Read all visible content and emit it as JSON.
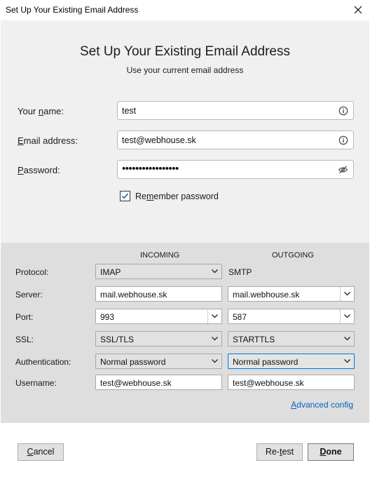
{
  "window": {
    "title": "Set Up Your Existing Email Address"
  },
  "header": {
    "title": "Set Up Your Existing Email Address",
    "subtitle": "Use your current email address"
  },
  "form": {
    "name": {
      "label_pre": "Your ",
      "label_key": "n",
      "label_post": "ame:",
      "value": "test"
    },
    "email": {
      "label_pre": "",
      "label_key": "E",
      "label_post": "mail address:",
      "value": "test@webhouse.sk"
    },
    "password": {
      "label_pre": "",
      "label_key": "P",
      "label_post": "assword:",
      "value": "•••••••••••••••••"
    },
    "remember": {
      "label_pre": "Re",
      "label_key": "m",
      "label_post": "ember password",
      "checked": true
    }
  },
  "config": {
    "incoming_header": "INCOMING",
    "outgoing_header": "OUTGOING",
    "labels": {
      "protocol": "Protocol:",
      "server": "Server:",
      "port": "Port:",
      "ssl": "SSL:",
      "authentication": "Authentication:",
      "username": "Username:"
    },
    "incoming": {
      "protocol": "IMAP",
      "server": "mail.webhouse.sk",
      "port": "993",
      "ssl": "SSL/TLS",
      "authentication": "Normal password",
      "username": "test@webhouse.sk"
    },
    "outgoing": {
      "protocol": "SMTP",
      "server": "mail.webhouse.sk",
      "port": "587",
      "ssl": "STARTTLS",
      "authentication": "Normal password",
      "username": "test@webhouse.sk"
    },
    "advanced_pre": "",
    "advanced_key": "A",
    "advanced_post": "dvanced config"
  },
  "buttons": {
    "cancel": {
      "pre": "",
      "key": "C",
      "post": "ancel"
    },
    "retest": {
      "pre": "Re-",
      "key": "t",
      "post": "est"
    },
    "done": {
      "pre": "",
      "key": "D",
      "post": "one"
    }
  },
  "colors": {
    "link": "#0063c5",
    "focus_border": "#0078d7",
    "top_bg": "#f0f0f0",
    "bottom_bg": "#dedede"
  }
}
